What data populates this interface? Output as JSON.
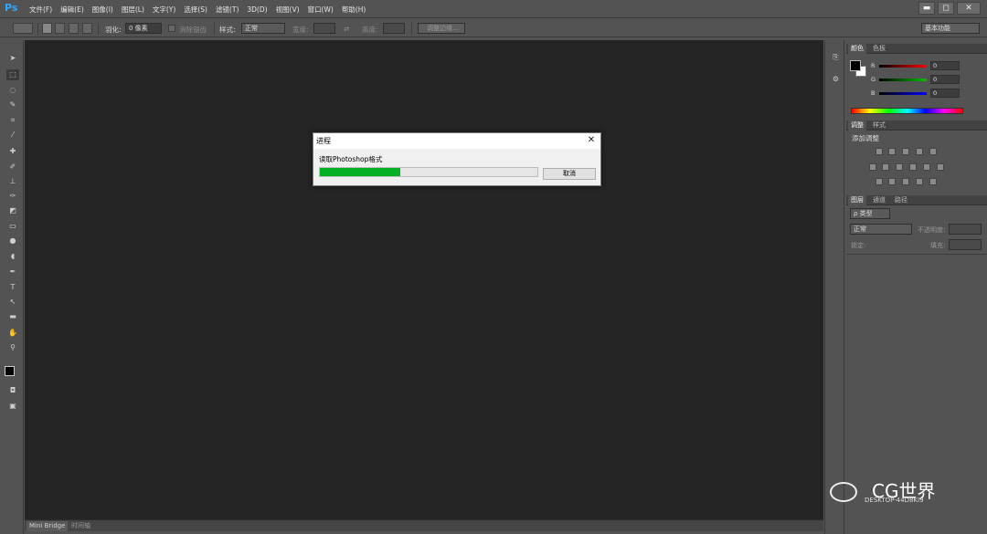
{
  "app": {
    "logo": "Ps"
  },
  "menu": [
    "文件(F)",
    "编辑(E)",
    "图像(I)",
    "图层(L)",
    "文字(Y)",
    "选择(S)",
    "滤镜(T)",
    "3D(D)",
    "视图(V)",
    "窗口(W)",
    "帮助(H)"
  ],
  "window_controls": {
    "minimize": "▬",
    "maximize": "◻",
    "close": "✕"
  },
  "options": {
    "feather_label": "羽化:",
    "feather_value": "0 像素",
    "antialias_label": "消除锯齿",
    "style_label": "样式:",
    "style_value": "正常",
    "width_label": "宽度:",
    "height_label": "高度:",
    "refine_button": "调整边缘...",
    "workspace": "基本功能"
  },
  "colors": {
    "accent": "#31a8ff",
    "progress": "#06b025"
  },
  "color_panel": {
    "tabs": [
      "颜色",
      "色板"
    ],
    "channels": [
      {
        "label": "R",
        "value": "0",
        "gradient": "#ff0000"
      },
      {
        "label": "G",
        "value": "0",
        "gradient": "#00c000"
      },
      {
        "label": "B",
        "value": "0",
        "gradient": "#0000ff"
      }
    ]
  },
  "adjust_panel": {
    "tabs": [
      "调整",
      "样式"
    ],
    "heading": "添加调整"
  },
  "layers_panel": {
    "tabs": [
      "图层",
      "通道",
      "路径"
    ],
    "filter_label": "ρ 类型",
    "blend_mode": "正常",
    "opacity_label": "不透明度:",
    "lock_label": "锁定:",
    "fill_label": "填充:"
  },
  "bottom_tabs": [
    "Mini Bridge",
    "时间轴"
  ],
  "dialog": {
    "title": "进程",
    "close": "✕",
    "message": "读取Photoshop格式",
    "progress": 0.37,
    "cancel": "取消"
  },
  "watermark": {
    "brand": "CG世界",
    "host": "DESKTOP-44D8KI9"
  }
}
